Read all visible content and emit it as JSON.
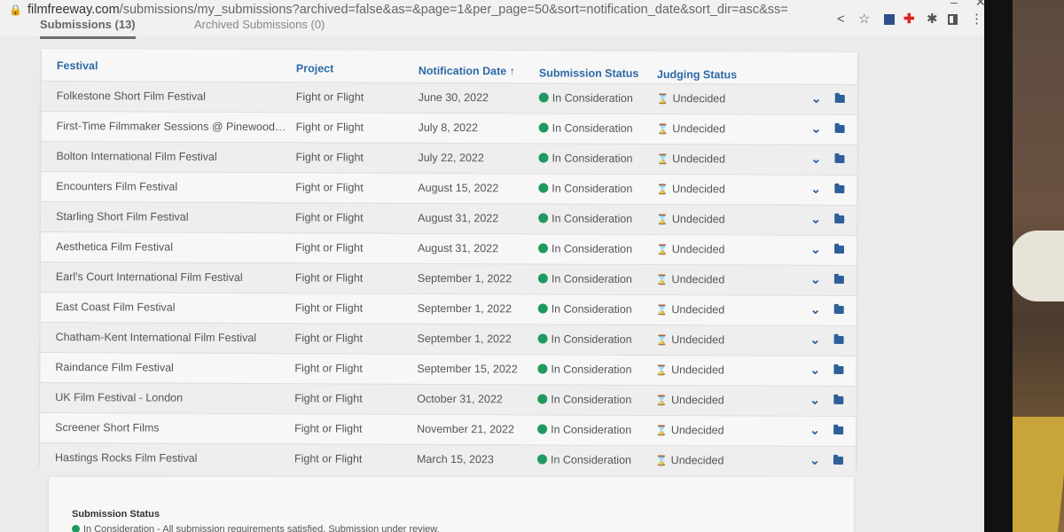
{
  "browser": {
    "url_host": "filmfreeway.com",
    "url_path": "/submissions/my_submissions?archived=false&as=&page=1&per_page=50&sort=notification_date&sort_dir=asc&ss="
  },
  "tabs": [
    {
      "label": "Submissions (13)"
    },
    {
      "label": "Archived Submissions (0)"
    }
  ],
  "table": {
    "headers": {
      "festival": "Festival",
      "project": "Project",
      "notification_date": "Notification Date ↑",
      "submission_status": "Submission Status",
      "judging_status": "Judging Status"
    },
    "rows": [
      {
        "festival": "Folkestone Short Film Festival",
        "project": "Fight or Flight",
        "date": "June 30, 2022",
        "submission_status": "In Consideration",
        "judging_status": "Undecided"
      },
      {
        "festival": "First-Time Filmmaker Sessions @ PinewoodSt...",
        "project": "Fight or Flight",
        "date": "July 8, 2022",
        "submission_status": "In Consideration",
        "judging_status": "Undecided"
      },
      {
        "festival": "Bolton International Film Festival",
        "project": "Fight or Flight",
        "date": "July 22, 2022",
        "submission_status": "In Consideration",
        "judging_status": "Undecided"
      },
      {
        "festival": "Encounters Film Festival",
        "project": "Fight or Flight",
        "date": "August 15, 2022",
        "submission_status": "In Consideration",
        "judging_status": "Undecided"
      },
      {
        "festival": "Starling Short Film Festival",
        "project": "Fight or Flight",
        "date": "August 31, 2022",
        "submission_status": "In Consideration",
        "judging_status": "Undecided"
      },
      {
        "festival": "Aesthetica Film Festival",
        "project": "Fight or Flight",
        "date": "August 31, 2022",
        "submission_status": "In Consideration",
        "judging_status": "Undecided"
      },
      {
        "festival": "Earl's Court International Film Festival",
        "project": "Fight or Flight",
        "date": "September 1, 2022",
        "submission_status": "In Consideration",
        "judging_status": "Undecided"
      },
      {
        "festival": "East Coast Film Festival",
        "project": "Fight or Flight",
        "date": "September 1, 2022",
        "submission_status": "In Consideration",
        "judging_status": "Undecided"
      },
      {
        "festival": "Chatham-Kent International Film Festival",
        "project": "Fight or Flight",
        "date": "September 1, 2022",
        "submission_status": "In Consideration",
        "judging_status": "Undecided"
      },
      {
        "festival": "Raindance Film Festival",
        "project": "Fight or Flight",
        "date": "September 15, 2022",
        "submission_status": "In Consideration",
        "judging_status": "Undecided"
      },
      {
        "festival": "UK Film Festival - London",
        "project": "Fight or Flight",
        "date": "October 31, 2022",
        "submission_status": "In Consideration",
        "judging_status": "Undecided"
      },
      {
        "festival": "Screener Short Films",
        "project": "Fight or Flight",
        "date": "November 21, 2022",
        "submission_status": "In Consideration",
        "judging_status": "Undecided"
      },
      {
        "festival": "Hastings Rocks Film Festival",
        "project": "Fight or Flight",
        "date": "March 15, 2023",
        "submission_status": "In Consideration",
        "judging_status": "Undecided"
      }
    ],
    "row_icons": [
      "chevron-down-icon",
      "folder-icon"
    ]
  },
  "legend": {
    "title": "Submission Status",
    "text": "In Consideration - All submission requirements satisfied. Submission under review."
  },
  "colors": {
    "header_link": "#2d6aa8",
    "status_green": "#1f9a5e",
    "action_blue": "#2d5f9a"
  }
}
